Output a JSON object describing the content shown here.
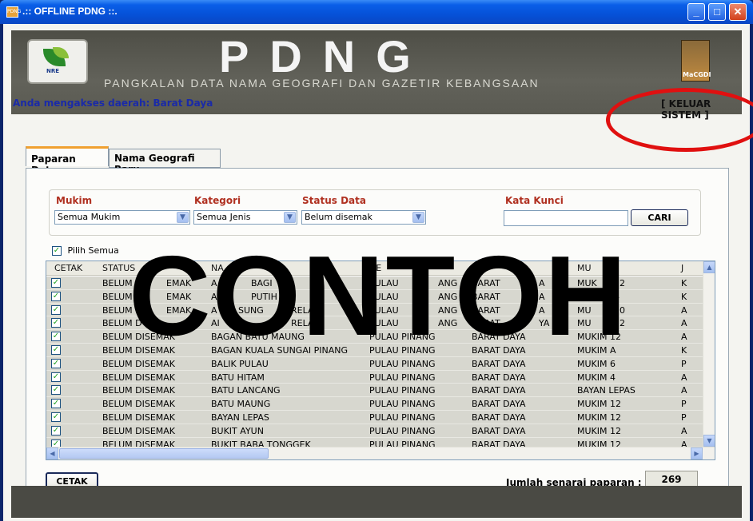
{
  "window": {
    "title": ".:: OFFLINE PDNG ::.",
    "app_icon_text": "PDNG",
    "minimize": "_",
    "maximize": "□",
    "close": "✕"
  },
  "banner": {
    "title": "PDNG",
    "subtitle": "PANGKALAN DATA NAMA GEOGRAFI DAN GAZETIR KEBANGSAAN",
    "left_logo_text": "NRE",
    "right_logo_text": "MaCGDI"
  },
  "access_text": "Anda mengakses daerah: Barat Daya",
  "logout_label": "[ KELUAR SISTEM ]",
  "tabs": [
    {
      "label": "Paparan Data",
      "active": true
    },
    {
      "label": "Nama Geografi Baru",
      "active": false
    }
  ],
  "filters": {
    "mukim": {
      "label": "Mukim",
      "value": "Semua Mukim"
    },
    "kategori": {
      "label": "Kategori",
      "value": "Semua Jenis"
    },
    "status": {
      "label": "Status Data",
      "value": "Belum disemak"
    },
    "keyword": {
      "label": "Kata Kunci",
      "value": ""
    },
    "search_button": "CARI"
  },
  "select_all_label": "Pilih Semua",
  "select_all_checked": true,
  "grid": {
    "columns": [
      "CETAK",
      "STATUS",
      "NA",
      "NE",
      "",
      "MU",
      "J"
    ],
    "rows": [
      [
        "BELUM",
        "EMAK",
        "A",
        "BAGI",
        "PULAU",
        "ANG",
        "BARAT",
        "A",
        "MUK",
        "12",
        "K"
      ],
      [
        "BELUM",
        "EMAK",
        "A",
        "PUTIH",
        "PULAU",
        "ANG",
        "BARAT",
        "A",
        "MU",
        "4",
        "K"
      ],
      [
        "BELUM",
        "EMAK",
        "A",
        "SUNG",
        "RELA",
        "PULAU",
        "ANG",
        "BARAT",
        "A",
        "MU",
        "10",
        "A"
      ],
      [
        "BELUM D",
        "",
        "AI",
        "RELA",
        "PULAU",
        "ANG",
        "BARAT",
        "YA",
        "MU",
        "12",
        "A"
      ]
    ],
    "full_rows": [
      {
        "status": "BELUM DISEMAK",
        "nama": "BAGAN BATU MAUNG",
        "negeri": "PULAU PINANG",
        "daerah": "BARAT DAYA",
        "mukim": "MUKIM 12",
        "j": "A"
      },
      {
        "status": "BELUM DISEMAK",
        "nama": "BAGAN KUALA SUNGAI PINANG",
        "negeri": "PULAU PINANG",
        "daerah": "BARAT DAYA",
        "mukim": "MUKIM A",
        "j": "K"
      },
      {
        "status": "BELUM DISEMAK",
        "nama": "BALIK PULAU",
        "negeri": "PULAU PINANG",
        "daerah": "BARAT DAYA",
        "mukim": "MUKIM 6",
        "j": "P"
      },
      {
        "status": "BELUM DISEMAK",
        "nama": "BATU HITAM",
        "negeri": "PULAU PINANG",
        "daerah": "BARAT DAYA",
        "mukim": "MUKIM 4",
        "j": "A"
      },
      {
        "status": "BELUM DISEMAK",
        "nama": "BATU LANCANG",
        "negeri": "PULAU PINANG",
        "daerah": "BARAT DAYA",
        "mukim": "BAYAN LEPAS",
        "j": "A"
      },
      {
        "status": "BELUM DISEMAK",
        "nama": "BATU MAUNG",
        "negeri": "PULAU PINANG",
        "daerah": "BARAT DAYA",
        "mukim": "MUKIM 12",
        "j": "P"
      },
      {
        "status": "BELUM DISEMAK",
        "nama": "BAYAN LEPAS",
        "negeri": "PULAU PINANG",
        "daerah": "BARAT DAYA",
        "mukim": "MUKIM 12",
        "j": "P"
      },
      {
        "status": "BELUM DISEMAK",
        "nama": "BUKIT AYUN",
        "negeri": "PULAU PINANG",
        "daerah": "BARAT DAYA",
        "mukim": "MUKIM 12",
        "j": "A"
      },
      {
        "status": "BELUM DISEMAK",
        "nama": "BUKIT BABA TONGGEK",
        "negeri": "PULAU PINANG",
        "daerah": "BARAT DAYA",
        "mukim": "MUKIM 12",
        "j": "A"
      }
    ],
    "partial_rows": [
      {
        "status": "BELUM",
        "status2": "EMAK",
        "nama": "A",
        "nama2": "BAGI",
        "negeri": "PULAU",
        "negeri2": "ANG",
        "daerah": "BARAT",
        "daerah2": "A",
        "mukim": "MUK",
        "mukim2": "12",
        "j": "K"
      },
      {
        "status": "BELUM",
        "status2": "EMAK",
        "nama": "A",
        "nama2": "PUTIH",
        "negeri": "PULAU",
        "negeri2": "ANG",
        "daerah": "BARAT",
        "daerah2": "A",
        "mukim": "MU",
        "mukim2": "4",
        "j": "K"
      },
      {
        "status": "BELUM",
        "status2": "EMAK",
        "nama": "A",
        "nama2": "SUNG",
        "nama3": "RELA",
        "negeri": "PULAU",
        "negeri2": "ANG",
        "daerah": "BARAT",
        "daerah2": "A",
        "mukim": "MU",
        "mukim2": "10",
        "j": "A"
      },
      {
        "status": "BELUM D",
        "status2": "",
        "nama": "AI",
        "nama2": "",
        "nama3": "RELA",
        "negeri": "PULAU",
        "negeri2": "ANG",
        "daerah": "BARAT",
        "daerah2": "YA",
        "mukim": "MU",
        "mukim2": "12",
        "j": "A"
      }
    ]
  },
  "watermark": "CONTOH",
  "print_button": "CETAK",
  "count_label": "Jumlah senarai paparan :",
  "count_value": "269"
}
